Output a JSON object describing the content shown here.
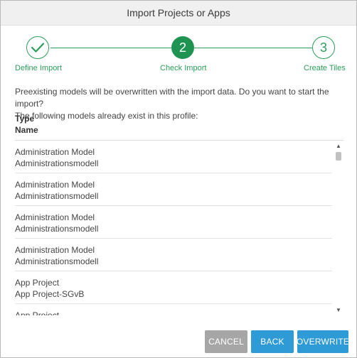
{
  "dialog": {
    "title": "Import Projects or Apps"
  },
  "steps": [
    {
      "number": "",
      "label": "Define Import",
      "state": "done",
      "icon": "check-icon"
    },
    {
      "number": "2",
      "label": "Check Import",
      "state": "active"
    },
    {
      "number": "3",
      "label": "Create Tiles",
      "state": "todo"
    }
  ],
  "message": {
    "line1": "Preexisting models will be overwritten with the import data. Do you want to start the import?",
    "line2": "The following models already exist in this profile:"
  },
  "columns": {
    "type": "Type",
    "name": "Name"
  },
  "items": [
    {
      "type": "Administration Model",
      "name": "Administrationsmodell"
    },
    {
      "type": "Administration Model",
      "name": "Administrationsmodell"
    },
    {
      "type": "Administration Model",
      "name": "Administrationsmodell"
    },
    {
      "type": "Administration Model",
      "name": "Administrationsmodell"
    },
    {
      "type": "App Project",
      "name": "App Project-SGvB"
    },
    {
      "type": "App Project",
      "name": ""
    }
  ],
  "buttons": {
    "cancel": "CANCEL",
    "back": "BACK",
    "overwrite": "OVERWRITE"
  },
  "colors": {
    "accent_green": "#2a9d5a",
    "button_blue": "#2e9ad6",
    "button_gray": "#a6a6a6"
  }
}
